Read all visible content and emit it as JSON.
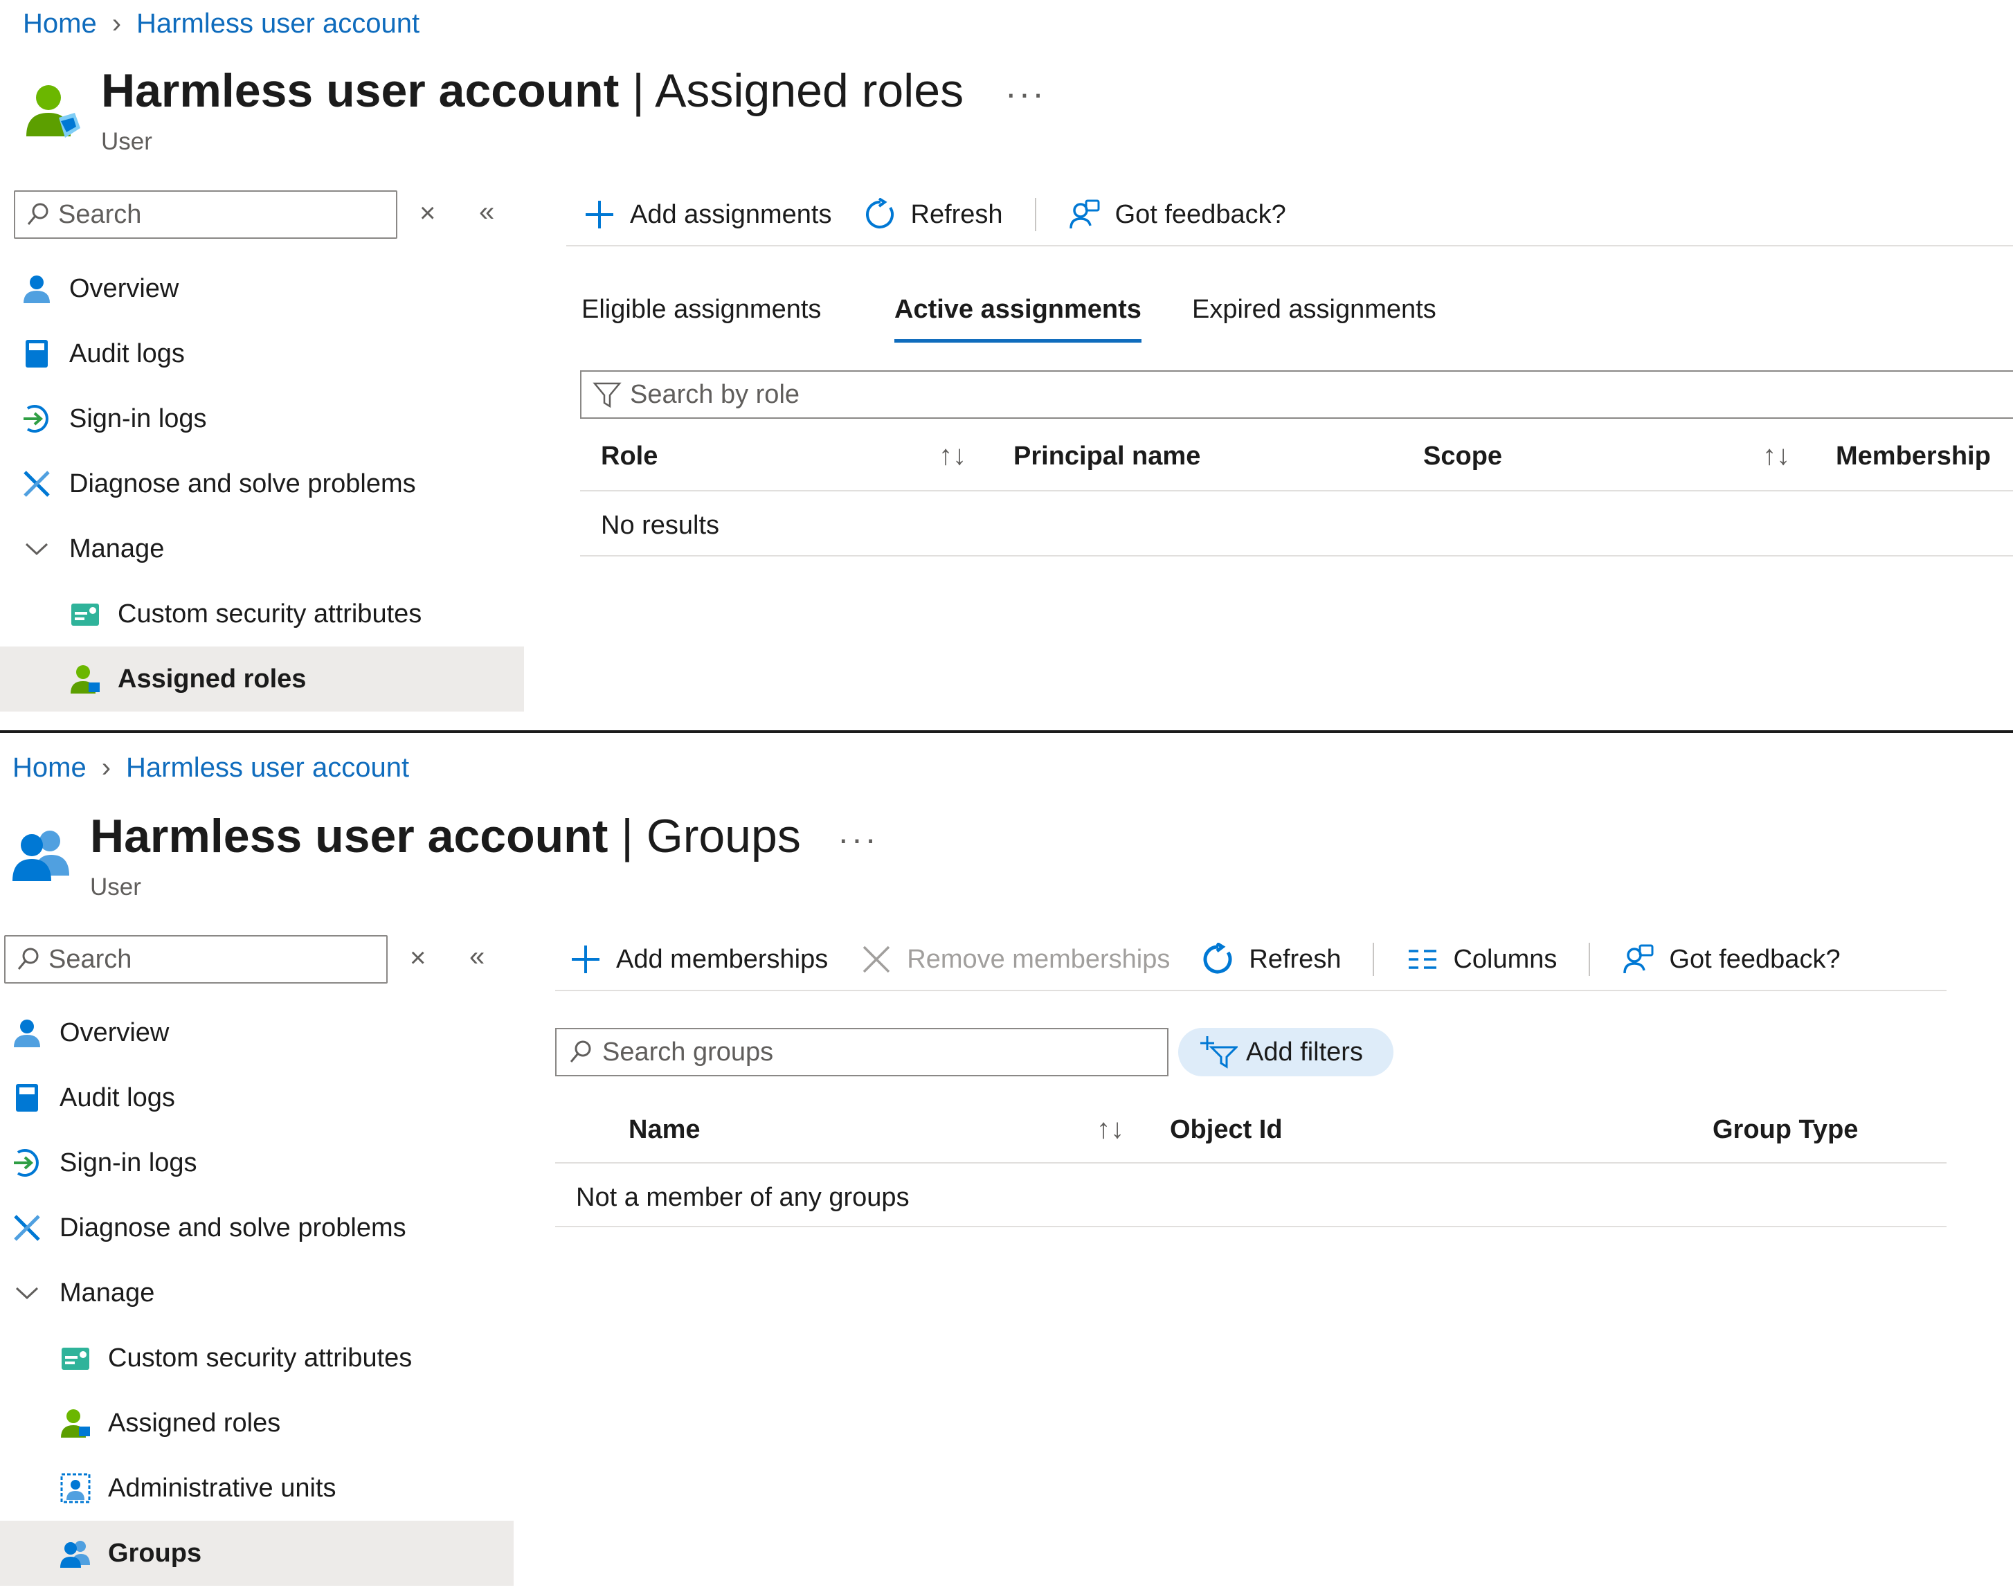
{
  "panel1": {
    "breadcrumb": {
      "home": "Home",
      "current": "Harmless user account"
    },
    "header": {
      "name": "Harmless user account",
      "separator": "|",
      "page": "Assigned roles",
      "subtitle": "User",
      "more": "···"
    },
    "sidebar": {
      "search_placeholder": "Search",
      "items": [
        {
          "label": "Overview",
          "icon": "user-icon"
        },
        {
          "label": "Audit logs",
          "icon": "audit-log-icon"
        },
        {
          "label": "Sign-in logs",
          "icon": "sign-in-icon"
        },
        {
          "label": "Diagnose and solve problems",
          "icon": "wrench-icon"
        },
        {
          "label": "Manage",
          "icon": "chevron-down-icon"
        },
        {
          "label": "Custom security attributes",
          "icon": "security-attributes-icon"
        },
        {
          "label": "Assigned roles",
          "icon": "assigned-roles-icon",
          "selected": true
        }
      ]
    },
    "toolbar": {
      "add": "Add assignments",
      "refresh": "Refresh",
      "feedback": "Got feedback?"
    },
    "tabs": [
      "Eligible assignments",
      "Active assignments",
      "Expired assignments"
    ],
    "active_tab": "Active assignments",
    "filter_placeholder": "Search by role",
    "columns": [
      "Role",
      "Principal name",
      "Scope",
      "Membership"
    ],
    "empty": "No results"
  },
  "panel2": {
    "breadcrumb": {
      "home": "Home",
      "current": "Harmless user account"
    },
    "header": {
      "name": "Harmless user account",
      "separator": "|",
      "page": "Groups",
      "subtitle": "User",
      "more": "···"
    },
    "sidebar": {
      "search_placeholder": "Search",
      "items": [
        {
          "label": "Overview",
          "icon": "user-icon"
        },
        {
          "label": "Audit logs",
          "icon": "audit-log-icon"
        },
        {
          "label": "Sign-in logs",
          "icon": "sign-in-icon"
        },
        {
          "label": "Diagnose and solve problems",
          "icon": "wrench-icon"
        },
        {
          "label": "Manage",
          "icon": "chevron-down-icon"
        },
        {
          "label": "Custom security attributes",
          "icon": "security-attributes-icon"
        },
        {
          "label": "Assigned roles",
          "icon": "assigned-roles-icon"
        },
        {
          "label": "Administrative units",
          "icon": "admin-units-icon"
        },
        {
          "label": "Groups",
          "icon": "groups-icon",
          "selected": true
        }
      ]
    },
    "toolbar": {
      "add": "Add memberships",
      "remove": "Remove memberships",
      "refresh": "Refresh",
      "columns": "Columns",
      "feedback": "Got feedback?"
    },
    "search_placeholder": "Search groups",
    "add_filters": "Add filters",
    "columns": [
      "Name",
      "Object Id",
      "Group Type"
    ],
    "empty": "Not a member of any groups"
  },
  "colors": {
    "link": "#0f6cbd",
    "selected_bg": "#edebe9",
    "pill_bg": "#deecf9",
    "accent": "#0078d4"
  }
}
